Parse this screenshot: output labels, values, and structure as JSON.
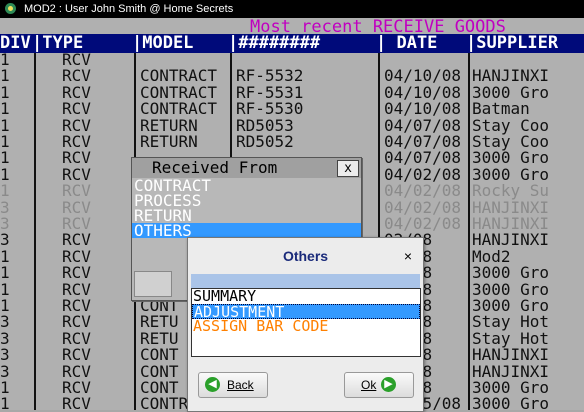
{
  "window": {
    "title": "MOD2 : User John Smith @ Home Secrets"
  },
  "banner": "Most recent RECEIVE GOODS",
  "columns": [
    "DIV",
    "|TYPE",
    "|MODEL",
    "|########",
    "|  DATE",
    "|SUPPLIER"
  ],
  "rows": [
    {
      "div": "1",
      "type": "RCV",
      "model": "",
      "num": "",
      "date": "",
      "supplier": "",
      "faded": false
    },
    {
      "div": "1",
      "type": "RCV",
      "model": "CONTRACT",
      "num": "RF-5532",
      "date": "04/10/08",
      "supplier": "HANJINXI",
      "faded": false
    },
    {
      "div": "1",
      "type": "RCV",
      "model": "CONTRACT",
      "num": "RF-5531",
      "date": "04/10/08",
      "supplier": "3000 Gro",
      "faded": false
    },
    {
      "div": "1",
      "type": "RCV",
      "model": "CONTRACT",
      "num": "RF-5530",
      "date": "04/10/08",
      "supplier": "Batman",
      "faded": false
    },
    {
      "div": "1",
      "type": "RCV",
      "model": "RETURN",
      "num": "RD5053",
      "date": "04/07/08",
      "supplier": "Stay Coo",
      "faded": false
    },
    {
      "div": "1",
      "type": "RCV",
      "model": "RETURN",
      "num": "RD5052",
      "date": "04/07/08",
      "supplier": "Stay Coo",
      "faded": false
    },
    {
      "div": "1",
      "type": "RCV",
      "model": "",
      "num": "",
      "date": "04/07/08",
      "supplier": "3000 Gro",
      "faded": false
    },
    {
      "div": "1",
      "type": "RCV",
      "model": "",
      "num": "",
      "date": "04/02/08",
      "supplier": "3000 Gro",
      "faded": false
    },
    {
      "div": "1",
      "type": "RCV",
      "model": "",
      "num": "I",
      "date": "04/02/08",
      "supplier": "Rocky Su",
      "faded": true
    },
    {
      "div": "3",
      "type": "RCV",
      "model": "",
      "num": "",
      "date": "04/02/08",
      "supplier": "HANJINXI",
      "faded": true
    },
    {
      "div": "3",
      "type": "RCV",
      "model": "",
      "num": "",
      "date": "04/02/08",
      "supplier": "HANJINXI",
      "faded": true
    },
    {
      "div": "3",
      "type": "RCV",
      "model": "",
      "num": "",
      "date": "02/08",
      "supplier": "HANJINXI",
      "faded": false
    },
    {
      "div": "1",
      "type": "RCV",
      "model": "",
      "num": "",
      "date": "02/08",
      "supplier": "Mod2",
      "faded": false
    },
    {
      "div": "1",
      "type": "RCV",
      "model": "",
      "num": "",
      "date": "26/08",
      "supplier": "3000 Gro",
      "faded": false
    },
    {
      "div": "1",
      "type": "RCV",
      "model": "",
      "num": "",
      "date": "26/08",
      "supplier": "3000 Gro",
      "faded": false
    },
    {
      "div": "1",
      "type": "RCV",
      "model": "CONT",
      "num": "",
      "date": "26/08",
      "supplier": "3000 Gro",
      "faded": false
    },
    {
      "div": "3",
      "type": "RCV",
      "model": "RETU",
      "num": "",
      "date": "26/08",
      "supplier": "Stay Hot",
      "faded": false
    },
    {
      "div": "3",
      "type": "RCV",
      "model": "RETU",
      "num": "",
      "date": "26/08",
      "supplier": "Stay Hot",
      "faded": false
    },
    {
      "div": "3",
      "type": "RCV",
      "model": "CONT",
      "num": "",
      "date": "26/08",
      "supplier": "HANJINXI",
      "faded": false
    },
    {
      "div": "3",
      "type": "RCV",
      "model": "CONT",
      "num": "",
      "date": "26/08",
      "supplier": "HANJINXI",
      "faded": false
    },
    {
      "div": "1",
      "type": "RCV",
      "model": "CONT",
      "num": "",
      "date": "25/08",
      "supplier": "3000 Gro",
      "faded": false
    },
    {
      "div": "1",
      "type": "RCV",
      "model": "CONTRACT",
      "num": "RF-5522",
      "date": "03/25/08",
      "supplier": "3000 Gro",
      "faded": false
    }
  ],
  "received_from": {
    "title": "Received From",
    "close_label": "x",
    "options": [
      "CONTRACT",
      "PROCESS",
      "RETURN",
      "OTHERS"
    ],
    "selected": "OTHERS"
  },
  "others": {
    "title": "Others",
    "close_label": "×",
    "options": [
      {
        "label": "SUMMARY",
        "color": "#000000"
      },
      {
        "label": "ADJUSTMENT",
        "color": "#ffffff"
      },
      {
        "label": "ASSIGN BAR CODE",
        "color": "#ff8000"
      }
    ],
    "selected": "ADJUSTMENT",
    "back_label": "Back",
    "ok_label": "Ok"
  },
  "colors": {
    "header_bg": "#000a7a",
    "banner": "#c000c0",
    "selection": "#3399ff"
  }
}
